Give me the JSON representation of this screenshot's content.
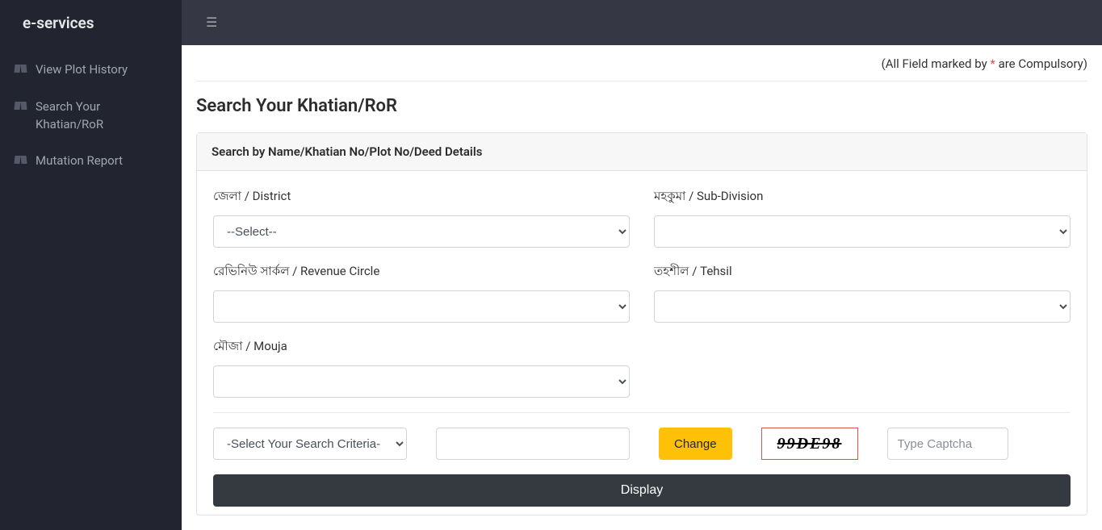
{
  "brand": "e-services",
  "sidebar": {
    "items": [
      {
        "label": "View Plot History"
      },
      {
        "label": "Search Your Khatian/RoR"
      },
      {
        "label": "Mutation Report"
      }
    ]
  },
  "compulsory": {
    "prefix": "(All Field marked by ",
    "star": "*",
    "suffix": " are Compulsory)"
  },
  "page_title": "Search Your Khatian/RoR",
  "panel_header": "Search by Name/Khatian No/Plot No/Deed Details",
  "form": {
    "district_label": "জেলা / District",
    "district_selected": "--Select--",
    "subdivision_label": "মহকুমা / Sub-Division",
    "revenue_label": "রেভিনিউ সার্কল / Revenue Circle",
    "tehsil_label": "তহশীল / Tehsil",
    "mouja_label": "মৌজা / Mouja",
    "criteria_selected": "-Select Your Search Criteria-",
    "change_btn": "Change",
    "captcha_value": "99DE98",
    "captcha_placeholder": "Type Captcha",
    "display_btn": "Display"
  }
}
